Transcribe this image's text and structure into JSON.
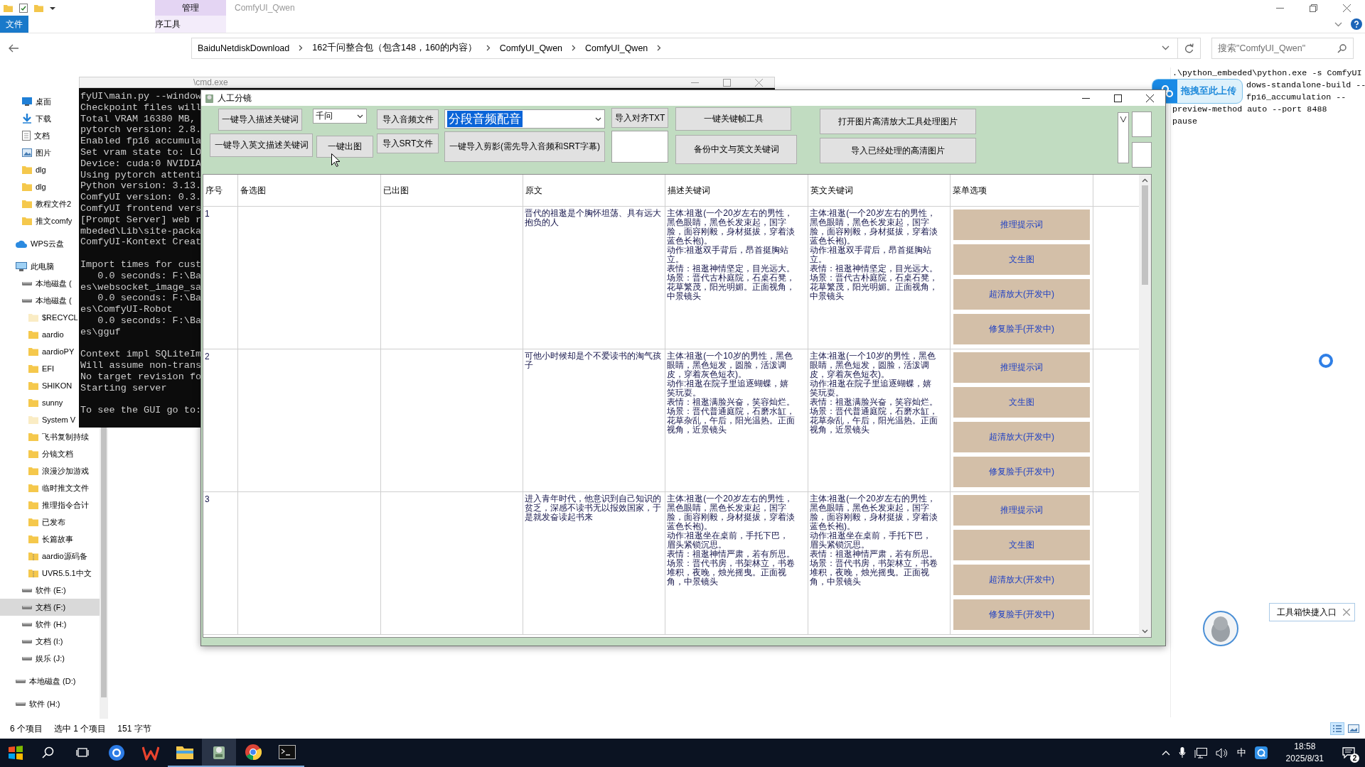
{
  "explorer": {
    "title": "ComfyUI_Qwen",
    "context_tab": "管理",
    "context_subtab": "序工具",
    "file_tab": "文件",
    "breadcrumb": [
      "BaiduNetdiskDownload",
      "162千问整合包（包含148，160的内容）",
      "ComfyUI_Qwen",
      "ComfyUI_Qwen"
    ],
    "search": {
      "placeholder": "搜索\"ComfyUI_Qwen\""
    },
    "quick_access": [
      {
        "label": "桌面",
        "kind": "desktop",
        "selected": false
      },
      {
        "label": "下载",
        "kind": "download",
        "selected": false
      },
      {
        "label": "文档",
        "kind": "doc",
        "selected": false
      },
      {
        "label": "图片",
        "kind": "picture",
        "selected": false
      },
      {
        "label": "dlg",
        "kind": "folder",
        "selected": false
      },
      {
        "label": "dlg",
        "kind": "folder",
        "selected": false
      },
      {
        "label": "教程文件2",
        "kind": "folder",
        "selected": false
      },
      {
        "label": "推文comfy",
        "kind": "folder",
        "selected": false
      }
    ],
    "tree": [
      {
        "label": "WPS云盘",
        "kind": "cloud",
        "selected": false
      },
      {
        "label": "此电脑",
        "kind": "pc",
        "selected": false,
        "children": [
          {
            "label": "本地磁盘 (",
            "kind": "drive",
            "selected": false
          },
          {
            "label": "本地磁盘 (",
            "kind": "drive",
            "selected": false,
            "children": [
              {
                "label": "$RECYCL",
                "kind": "folder_hidden",
                "selected": false
              },
              {
                "label": "aardio",
                "kind": "folder",
                "selected": false
              },
              {
                "label": "aardioPY",
                "kind": "folder",
                "selected": false
              },
              {
                "label": "EFI",
                "kind": "folder",
                "selected": false
              },
              {
                "label": "SHIKON",
                "kind": "folder",
                "selected": false
              },
              {
                "label": "sunny",
                "kind": "folder",
                "selected": false
              },
              {
                "label": "System V",
                "kind": "folder_hidden",
                "selected": false
              },
              {
                "label": "飞书复制持续",
                "kind": "folder",
                "selected": false
              },
              {
                "label": "分镜文档",
                "kind": "folder",
                "selected": false
              },
              {
                "label": "浪漫沙加游戏",
                "kind": "folder",
                "selected": false
              },
              {
                "label": "临时推文文件",
                "kind": "folder",
                "selected": false
              },
              {
                "label": "推理指令合计",
                "kind": "folder",
                "selected": false
              },
              {
                "label": "已发布",
                "kind": "folder",
                "selected": false
              },
              {
                "label": "长篇故事",
                "kind": "folder",
                "selected": false
              },
              {
                "label": "aardio源码备",
                "kind": "zip",
                "selected": false
              },
              {
                "label": "UVR5.5.1中文",
                "kind": "zip",
                "selected": false
              }
            ]
          },
          {
            "label": "软件 (E:)",
            "kind": "drive",
            "selected": false
          },
          {
            "label": "文档 (F:)",
            "kind": "drive",
            "selected": true
          },
          {
            "label": "软件 (H:)",
            "kind": "drive",
            "selected": false
          },
          {
            "label": "文档 (I:)",
            "kind": "drive",
            "selected": false
          },
          {
            "label": "娱乐 (J:)",
            "kind": "drive",
            "selected": false
          }
        ]
      },
      {
        "label": "本地磁盘 (D:)",
        "kind": "drive",
        "selected": false
      },
      {
        "label": "软件 (H:)",
        "kind": "drive",
        "selected": false
      }
    ],
    "status_bar": [
      "6 个项目",
      "选中 1 个项目",
      "151 字节"
    ]
  },
  "cmd_window": {
    "title": "\\cmd.exe",
    "blocks": [
      [
        "fyUI\\main.py --window",
        "Checkpoint files will",
        "Total VRAM 16380 MB,",
        "pytorch version: 2.8.",
        "Enabled fp16 accumula",
        "Set vram state to: LO",
        "Device: cuda:0 NVIDIA",
        "Using pytorch attenti",
        "Python version: 3.13.",
        "ComfyUI version: 0.3.",
        "ComfyUI frontend vers",
        "[Prompt Server] web r",
        "mbeded\\Lib\\site-packa",
        "ComfyUI-Kontext Creat"
      ],
      [
        "Import times for cust",
        "   0.0 seconds: F:\\Ba",
        "es\\websocket_image_sa",
        "   0.0 seconds: F:\\Ba",
        "es\\ComfyUI-Robot",
        "   0.0 seconds: F:\\Ba",
        "es\\gguf"
      ],
      [
        "Context impl SQLiteIm",
        "Will assume non-trans",
        "No target revision fo",
        "Starting server"
      ],
      [
        "To see the GUI go to:"
      ]
    ]
  },
  "script_window": {
    "lines": [
      {
        "text": ".\\python_embeded\\python.exe -s ComfyUI",
        "covered": false
      },
      {
        "text": "dows-standalone-build --",
        "covered": true
      },
      {
        "text": "fp16_accumulation --",
        "covered": true
      },
      {
        "text": "preview-method auto --port 8488",
        "covered": false
      },
      {
        "text": "pause",
        "covered": false
      }
    ]
  },
  "upload_popup": {
    "label": "拖拽至此上传"
  },
  "app": {
    "title": "人工分镜",
    "toolbar": [
      [
        {
          "kind": "button",
          "label": "一键导入描述关键词"
        },
        {
          "kind": "button",
          "label": "一键导入英文描述关键词"
        }
      ],
      [
        {
          "kind": "combo",
          "value": "千问",
          "highlighted": false
        },
        {
          "kind": "button",
          "label": "一键出图"
        }
      ],
      [
        {
          "kind": "button",
          "label": "导入音频文件"
        },
        {
          "kind": "button",
          "label": "导入SRT文件"
        }
      ],
      [
        {
          "kind": "combo",
          "value": "分段音频配音",
          "highlighted": true
        },
        {
          "kind": "button",
          "label": "一键导入剪影(需先导入音频和SRT字幕)"
        }
      ],
      [
        {
          "kind": "button",
          "label": "导入对齐TXT"
        },
        {
          "kind": "box"
        }
      ],
      [
        {
          "kind": "button",
          "label": "一键关键帧工具"
        },
        {
          "kind": "button",
          "label": "备份中文与英文关键词"
        }
      ],
      [
        {
          "kind": "button",
          "label": "打开图片高清放大工具处理图片"
        },
        {
          "kind": "button",
          "label": "导入已经处理的高清图片"
        }
      ]
    ],
    "table": {
      "columns": [
        "序号",
        "备选图",
        "已出图",
        "原文",
        "描述关键词",
        "英文关键词",
        "菜单选项"
      ],
      "rows": [
        {
          "no": "1",
          "text": "晋代的祖逖是个胸怀坦荡、具有远大抱负的人",
          "desc": [
            "主体:祖逖(一个20岁左右的男性，黑色眼睛，黑色长发束起，国字脸，面容刚毅，身材挺拔，穿着淡蓝色长袍)。",
            "动作:祖逖双手背后，昂首挺胸站立。",
            "表情：祖逖神情坚定，目光远大。",
            "场景：晋代古朴庭院，石桌石凳，花草繁茂，阳光明媚。正面视角，中景镜头"
          ],
          "en": [
            "主体:祖逖(一个20岁左右的男性，黑色眼睛，黑色长发束起，国字脸，面容刚毅，身材挺拔，穿着淡蓝色长袍)。",
            "动作:祖逖双手背后，昂首挺胸站立。",
            "表情：祖逖神情坚定，目光远大。",
            "场景：晋代古朴庭院，石桌石凳，花草繁茂，阳光明媚。正面视角，中景镜头"
          ],
          "menu": [
            "推理提示词",
            "文生图",
            "超清放大(开发中)",
            "修复脸手(开发中)"
          ]
        },
        {
          "no": "2",
          "text": "可他小时候却是个不爱读书的淘气孩子",
          "desc": [
            "主体:祖逖(一个10岁的男性，黑色眼睛，黑色短发，圆脸，活泼调皮，穿着灰色短衣)。",
            "动作:祖逖在院子里追逐蝴蝶，嬉笑玩耍。",
            "表情：祖逖满脸兴奋，笑容灿烂。",
            "场景：晋代普通庭院，石磨水缸，花草杂乱，午后，阳光温热。正面视角，近景镜头"
          ],
          "en": [
            "主体:祖逖(一个10岁的男性，黑色眼睛，黑色短发，圆脸，活泼调皮，穿着灰色短衣)。",
            "动作:祖逖在院子里追逐蝴蝶，嬉笑玩耍。",
            "表情：祖逖满脸兴奋，笑容灿烂。",
            "场景：晋代普通庭院，石磨水缸，花草杂乱，午后，阳光温热。正面视角，近景镜头"
          ],
          "menu": [
            "推理提示词",
            "文生图",
            "超清放大(开发中)",
            "修复脸手(开发中)"
          ]
        },
        {
          "no": "3",
          "text": "进入青年时代，他意识到自己知识的贫乏，深感不读书无以报效国家，于是就发奋读起书来",
          "desc": [
            "主体:祖逖(一个20岁左右的男性，黑色眼睛，黑色长发束起，国字脸，面容刚毅，身材挺拔，穿着淡蓝色长袍)。",
            "动作:祖逖坐在桌前，手托下巴，眉头紧锁沉思。",
            "表情：祖逖神情严肃，若有所思。",
            "场景：晋代书房，书架林立，书卷堆积，夜晚，烛光摇曳。正面视角，中景镜头"
          ],
          "en": [
            "主体:祖逖(一个20岁左右的男性，黑色眼睛，黑色长发束起，国字脸，面容刚毅，身材挺拔，穿着淡蓝色长袍)。",
            "动作:祖逖坐在桌前，手托下巴，眉头紧锁沉思。",
            "表情：祖逖神情严肃，若有所思。",
            "场景：晋代书房，书架林立，书卷堆积，夜晚，烛光摇曳。正面视角，中景镜头"
          ],
          "menu": [
            "推理提示词",
            "文生图",
            "超清放大(开发中)",
            "修复脸手(开发中)"
          ]
        }
      ]
    }
  },
  "tooltip": {
    "label": "工具箱快捷入口"
  },
  "tray": {
    "ime": "中",
    "time": "18:58",
    "date": "2025/8/31",
    "notifications": "2"
  }
}
